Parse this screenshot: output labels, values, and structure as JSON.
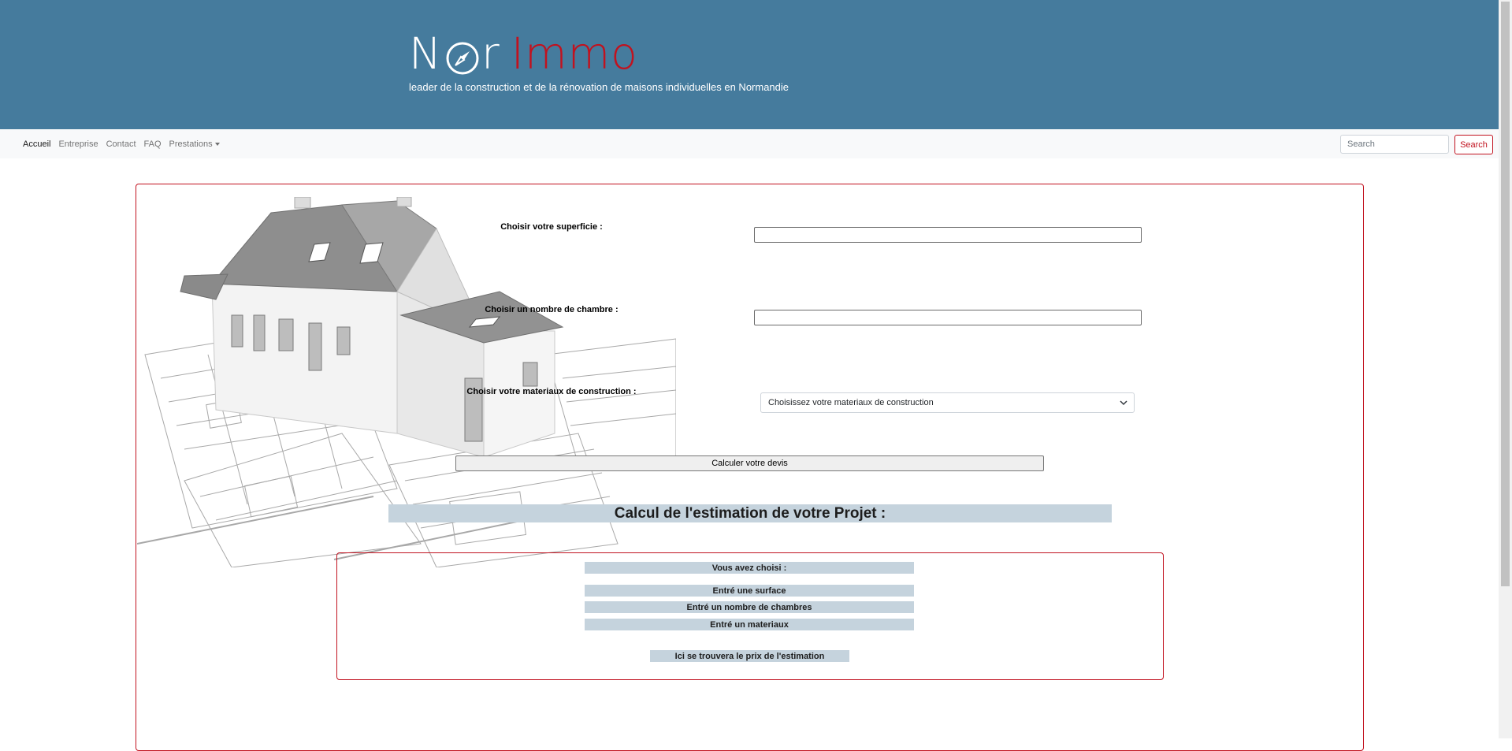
{
  "header": {
    "logo_part1": "N",
    "logo_part1b": "r",
    "logo_part2": "Immo",
    "tagline": "leader de la construction et de la rénovation de maisons individuelles en Normandie"
  },
  "nav": {
    "links": [
      "Accueil",
      "Entreprise",
      "Contact",
      "FAQ",
      "Prestations"
    ],
    "search_placeholder": "Search",
    "search_button": "Search"
  },
  "form": {
    "surface_label": "Choisir votre superficie :",
    "surface_value": "",
    "chambres_label": "Choisir un nombre de chambre :",
    "chambres_value": "",
    "materiaux_label": "Choisir votre materiaux de construction :",
    "materiaux_selected": "Choisissez votre materiaux de construction",
    "submit_label": "Calculer votre devis"
  },
  "estimate": {
    "title": "Calcul de l'estimation de votre Projet :",
    "chosen_heading": "Vous avez choisi :",
    "surface_line": "Entré une surface",
    "chambres_line": "Entré un nombre de chambres",
    "materiaux_line": "Entré un materiaux",
    "price_line": "Ici se trouvera le prix de l'estimation"
  },
  "colors": {
    "header_bg": "#457b9d",
    "accent_red": "#c1121f",
    "highlight_bar": "#c5d3dd"
  }
}
